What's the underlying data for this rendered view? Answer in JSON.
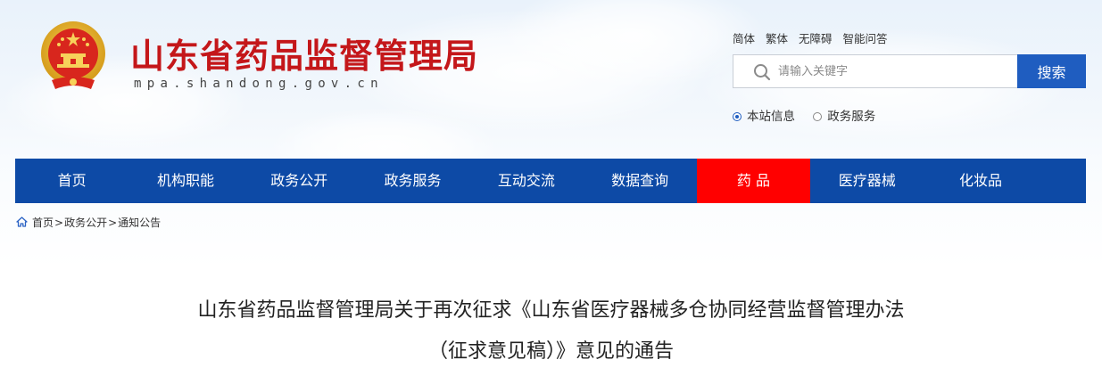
{
  "header": {
    "site_title": "山东省药品监督管理局",
    "site_domain": "mpa.shandong.gov.cn",
    "emblem_icon": "national-emblem-icon"
  },
  "util_links": [
    "简体",
    "繁体",
    "无障碍",
    "智能问答"
  ],
  "search": {
    "placeholder": "请输入关键字",
    "button_label": "搜索",
    "icon": "search-icon",
    "scopes": [
      {
        "label": "本站信息",
        "checked": true
      },
      {
        "label": "政务服务",
        "checked": false
      }
    ]
  },
  "nav": {
    "items": [
      "首页",
      "机构职能",
      "政务公开",
      "政务服务",
      "互动交流",
      "数据查询",
      "药 品",
      "医疗器械",
      "化妆品"
    ],
    "active_index": 6,
    "colors": {
      "bar": "#0d4aa6",
      "active": "#ff0000"
    }
  },
  "breadcrumb": {
    "icon": "home-icon",
    "items": [
      "首页",
      "政务公开",
      "通知公告"
    ],
    "separator": ">"
  },
  "article": {
    "title_line1": "山东省药品监督管理局关于再次征求《山东省医疗器械多仓协同经营监督管理办法",
    "title_line2": "（征求意见稿）》意见的通告"
  },
  "colors": {
    "title_red": "#c4171a",
    "search_blue": "#1f5dc0"
  }
}
